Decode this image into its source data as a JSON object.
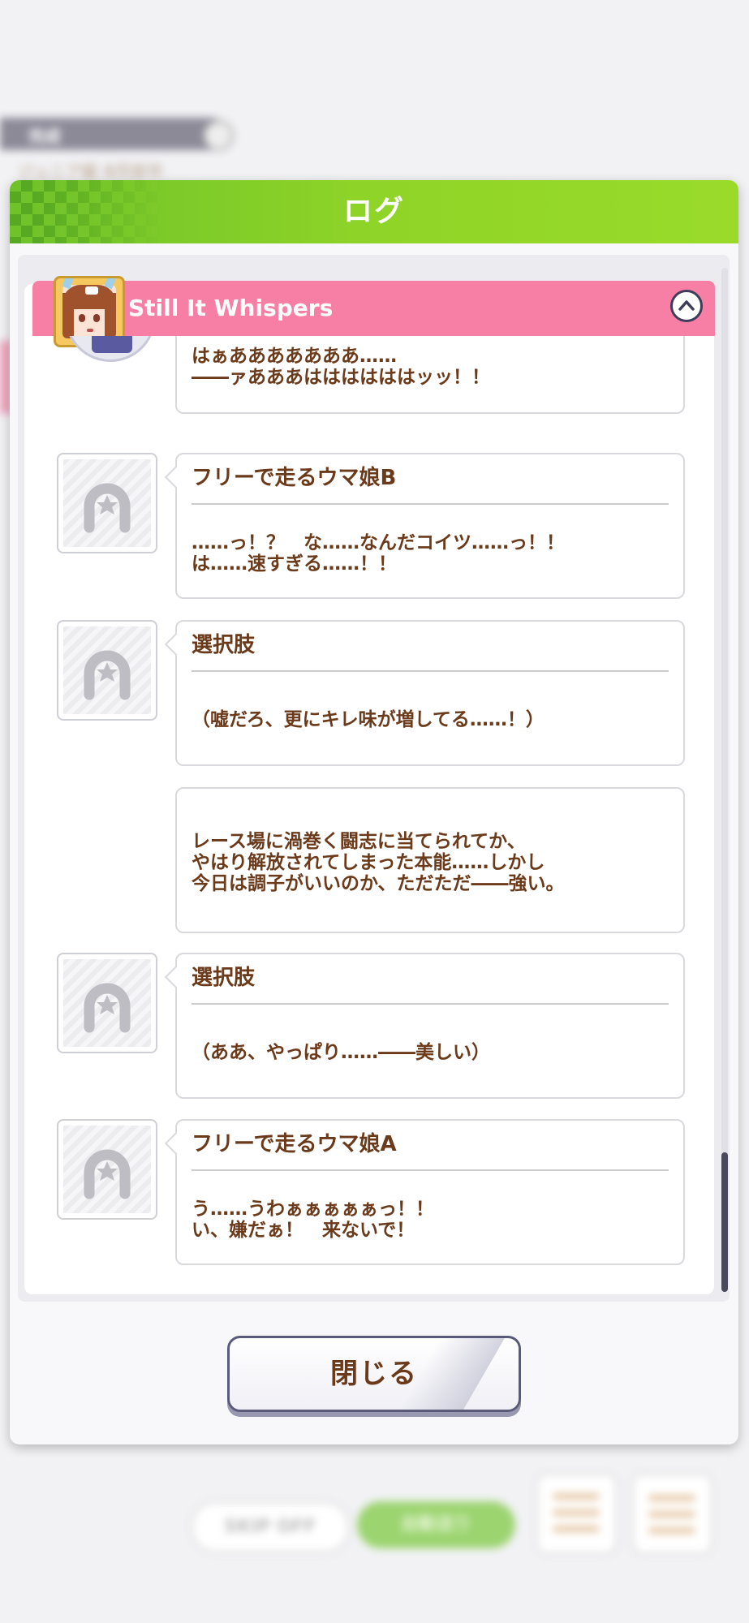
{
  "background": {
    "bar_label": "完成",
    "sub_label": "ジュニア級 8月前半",
    "skip_label": "SKIP OFF",
    "auto_label": "自動送り"
  },
  "panel": {
    "title": "ログ",
    "story_title": "Still It Whispers",
    "close_label": "閉じる"
  },
  "entries": [
    {
      "speaker": "",
      "text": "はぁあああああああ……\n――ァあああははははははッッ！！"
    },
    {
      "speaker": "フリーで走るウマ娘B",
      "text": "……っ！？　な……なんだコイツ……っ！！\nは……速すぎる……！！"
    },
    {
      "speaker": "選択肢",
      "text": "（嘘だろ、更にキレ味が増してる……！）"
    },
    {
      "speaker": "",
      "text": "レース場に渦巻く闘志に当てられてか、\nやはり解放されてしまった本能……しかし\n今日は調子がいいのか、ただただ――強い。"
    },
    {
      "speaker": "選択肢",
      "text": "（ああ、やっぱり……――美しい）"
    },
    {
      "speaker": "フリーで走るウマ娘A",
      "text": "う……うわぁぁぁぁぁっ！！\nい、嫌だぁ！　来ないで！"
    }
  ],
  "icons": {
    "placeholder": "horseshoe-star-icon",
    "collapse": "chevron-up-icon"
  },
  "colors": {
    "header_green": "#8fd428",
    "title_pink": "#f77fa6",
    "text_brown": "#6b3a1a"
  }
}
